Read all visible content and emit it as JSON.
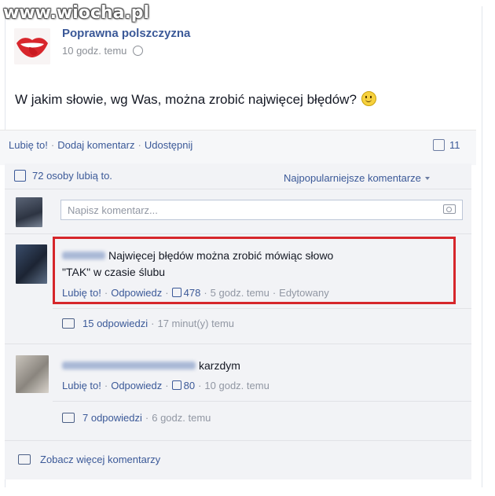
{
  "watermark": "www.wiocha.pl",
  "post": {
    "page_name": "Poprawna polszczyzna",
    "time": "10 godz. temu",
    "text": "W jakim słowie, wg Was, można zrobić najwięcej błędów?"
  },
  "actions": {
    "like": "Lubię to!",
    "comment": "Dodaj komentarz",
    "share": "Udostępnij",
    "comment_count": "11"
  },
  "likes": {
    "text": "72 osoby lubią to.",
    "sort": "Najpopularniejsze komentarze"
  },
  "comment_box": {
    "placeholder": "Napisz komentarz..."
  },
  "comments": [
    {
      "text_line1": "Najwięcej błędów można zrobić mówiąc słowo",
      "text_line2": "\"TAK\" w czasie ślubu",
      "like": "Lubię to!",
      "reply": "Odpowiedz",
      "likes": "478",
      "time": "5 godz. temu",
      "edited": "Edytowany",
      "replies": "15 odpowiedzi",
      "replies_time": "17 minut(y) temu"
    },
    {
      "text": "karzdym",
      "like": "Lubię to!",
      "reply": "Odpowiedz",
      "likes": "80",
      "time": "10 godz. temu",
      "replies": "7 odpowiedzi",
      "replies_time": "6 godz. temu"
    }
  ],
  "see_more": "Zobacz więcej komentarzy",
  "colors": {
    "link": "#3b5998",
    "highlight": "#d6262b",
    "ufi_background": "#f2f3f6"
  }
}
